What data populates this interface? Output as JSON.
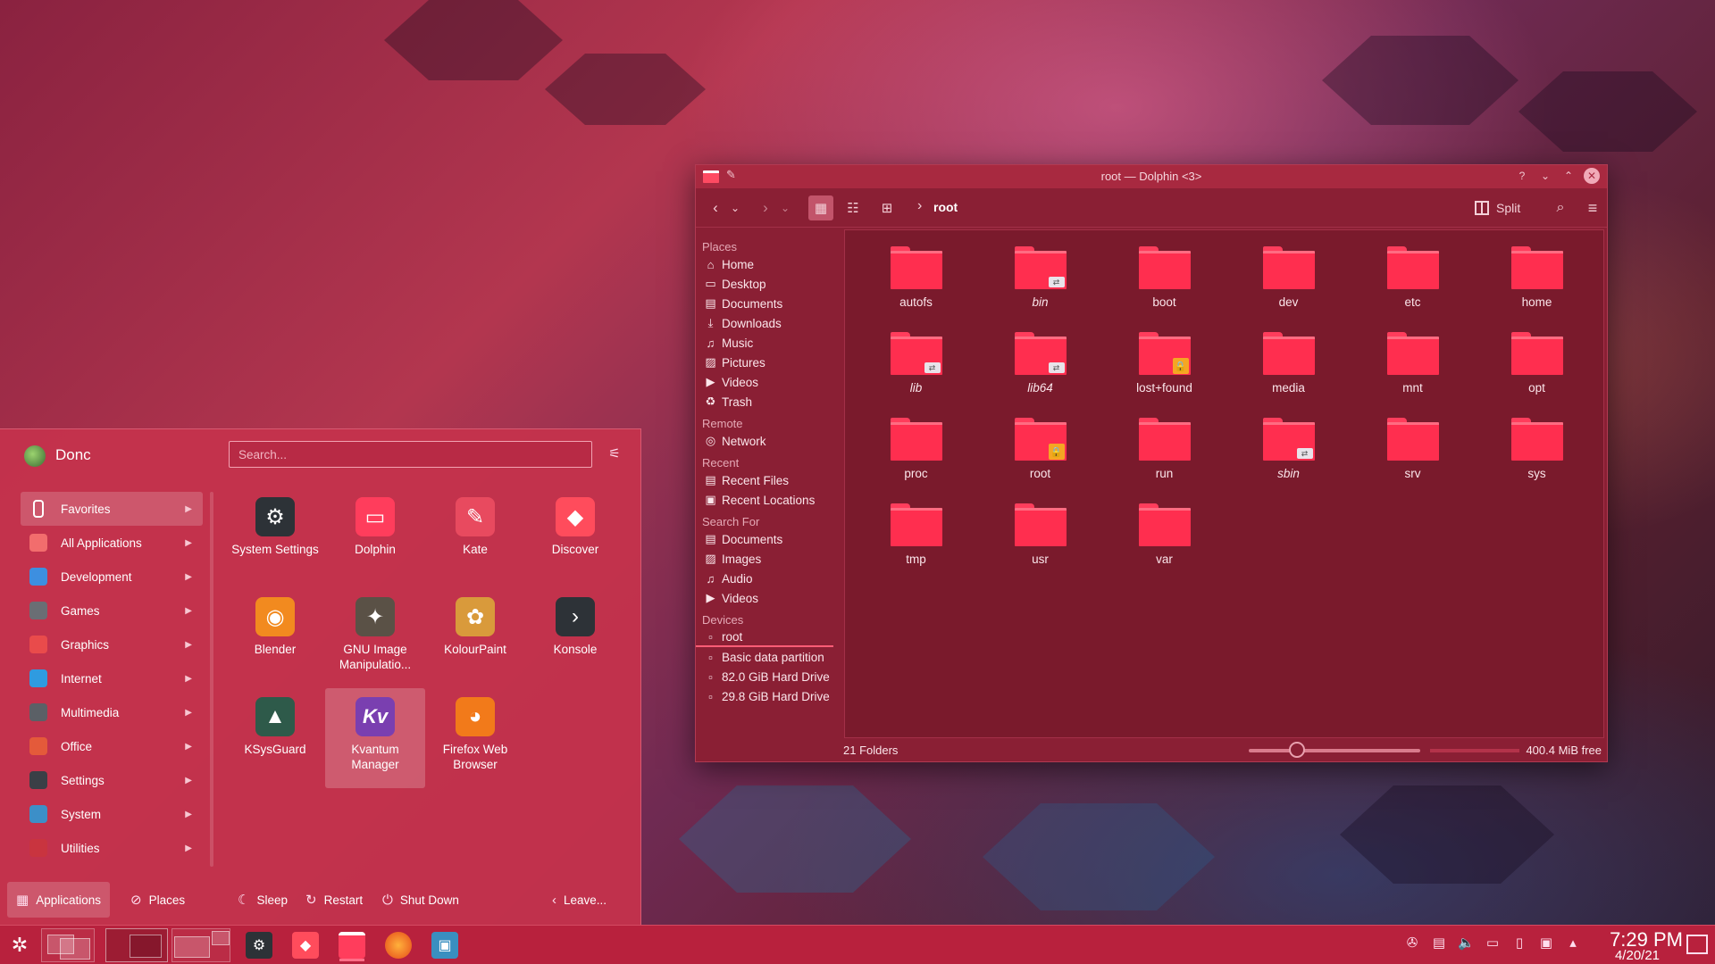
{
  "dolphin": {
    "title": "root — Dolphin <3>",
    "breadcrumb": "root",
    "split_label": "Split",
    "sections": [
      {
        "title": "Places",
        "items": [
          {
            "label": "Home",
            "icon": "home-icon"
          },
          {
            "label": "Desktop",
            "icon": "desktop-icon"
          },
          {
            "label": "Documents",
            "icon": "document-icon"
          },
          {
            "label": "Downloads",
            "icon": "download-icon"
          },
          {
            "label": "Music",
            "icon": "music-icon"
          },
          {
            "label": "Pictures",
            "icon": "picture-icon"
          },
          {
            "label": "Videos",
            "icon": "video-icon"
          },
          {
            "label": "Trash",
            "icon": "trash-icon"
          }
        ]
      },
      {
        "title": "Remote",
        "items": [
          {
            "label": "Network",
            "icon": "network-icon"
          }
        ]
      },
      {
        "title": "Recent",
        "items": [
          {
            "label": "Recent Files",
            "icon": "recent-files-icon"
          },
          {
            "label": "Recent Locations",
            "icon": "recent-locations-icon"
          }
        ]
      },
      {
        "title": "Search For",
        "items": [
          {
            "label": "Documents",
            "icon": "document-icon"
          },
          {
            "label": "Images",
            "icon": "picture-icon"
          },
          {
            "label": "Audio",
            "icon": "music-icon"
          },
          {
            "label": "Videos",
            "icon": "video-icon"
          }
        ]
      },
      {
        "title": "Devices",
        "items": [
          {
            "label": "root",
            "icon": "drive-icon"
          },
          {
            "label": "Basic data partition",
            "icon": "drive-icon"
          },
          {
            "label": "82.0 GiB Hard Drive",
            "icon": "drive-icon"
          },
          {
            "label": "29.8 GiB Hard Drive",
            "icon": "drive-icon"
          }
        ]
      }
    ],
    "folders": [
      {
        "name": "autofs",
        "badge": "",
        "italic": false
      },
      {
        "name": "bin",
        "badge": "link",
        "italic": true
      },
      {
        "name": "boot",
        "badge": "",
        "italic": false
      },
      {
        "name": "dev",
        "badge": "",
        "italic": false
      },
      {
        "name": "etc",
        "badge": "",
        "italic": false
      },
      {
        "name": "home",
        "badge": "",
        "italic": false
      },
      {
        "name": "lib",
        "badge": "link",
        "italic": true
      },
      {
        "name": "lib64",
        "badge": "link",
        "italic": true
      },
      {
        "name": "lost+found",
        "badge": "lock",
        "italic": false
      },
      {
        "name": "media",
        "badge": "",
        "italic": false
      },
      {
        "name": "mnt",
        "badge": "",
        "italic": false
      },
      {
        "name": "opt",
        "badge": "",
        "italic": false
      },
      {
        "name": "proc",
        "badge": "",
        "italic": false
      },
      {
        "name": "root",
        "badge": "lock",
        "italic": false
      },
      {
        "name": "run",
        "badge": "",
        "italic": false
      },
      {
        "name": "sbin",
        "badge": "link",
        "italic": true
      },
      {
        "name": "srv",
        "badge": "",
        "italic": false
      },
      {
        "name": "sys",
        "badge": "",
        "italic": false
      },
      {
        "name": "tmp",
        "badge": "",
        "italic": false
      },
      {
        "name": "usr",
        "badge": "",
        "italic": false
      },
      {
        "name": "var",
        "badge": "",
        "italic": false
      }
    ],
    "status": "21 Folders",
    "free_space": "400.4 MiB free"
  },
  "launcher": {
    "user": "Donc",
    "search_placeholder": "Search...",
    "categories": [
      {
        "label": "Favorites",
        "icon": "bookmark-icon",
        "color": "#ffffff"
      },
      {
        "label": "All Applications",
        "icon": "grid-icon",
        "color": "#f26d6d"
      },
      {
        "label": "Development",
        "icon": "development-icon",
        "color": "#3d8fe0"
      },
      {
        "label": "Games",
        "icon": "gamepad-icon",
        "color": "#6a6e74"
      },
      {
        "label": "Graphics",
        "icon": "graphics-icon",
        "color": "#e94b4b"
      },
      {
        "label": "Internet",
        "icon": "globe-icon",
        "color": "#2f9be0"
      },
      {
        "label": "Multimedia",
        "icon": "multimedia-icon",
        "color": "#5b6066"
      },
      {
        "label": "Office",
        "icon": "office-icon",
        "color": "#e45a3a"
      },
      {
        "label": "Settings",
        "icon": "settings-icon",
        "color": "#3a3f46"
      },
      {
        "label": "System",
        "icon": "system-icon",
        "color": "#3c8fc8"
      },
      {
        "label": "Utilities",
        "icon": "utilities-icon",
        "color": "#c9343f"
      }
    ],
    "apps": [
      {
        "label": "System Settings",
        "icon": "system-settings-icon",
        "color": "#2d3237",
        "glyph": "⚙"
      },
      {
        "label": "Dolphin",
        "icon": "dolphin-icon",
        "color": "#ff3d5c",
        "glyph": "▭"
      },
      {
        "label": "Kate",
        "icon": "kate-icon",
        "color": "#e84a5f",
        "glyph": "✎"
      },
      {
        "label": "Discover",
        "icon": "discover-icon",
        "color": "#ff4c5c",
        "glyph": "◆"
      },
      {
        "label": "Blender",
        "icon": "blender-icon",
        "color": "#f28a1f",
        "glyph": "◉"
      },
      {
        "label": "GNU Image Manipulatio...",
        "icon": "gimp-icon",
        "color": "#5a5146",
        "glyph": "✦"
      },
      {
        "label": "KolourPaint",
        "icon": "kolourpaint-icon",
        "color": "#d99a3b",
        "glyph": "✿"
      },
      {
        "label": "Konsole",
        "icon": "konsole-icon",
        "color": "#2d3237",
        "glyph": "›"
      },
      {
        "label": "KSysGuard",
        "icon": "ksysguard-icon",
        "color": "#2e5a4a",
        "glyph": "▲"
      },
      {
        "label": "Kvantum Manager",
        "icon": "kvantum-icon",
        "color": "#7a3fb0",
        "glyph": "Kv"
      },
      {
        "label": "Firefox Web Browser",
        "icon": "firefox-icon",
        "color": "#f27a1a",
        "glyph": "◕"
      }
    ],
    "footer": {
      "applications": "Applications",
      "places": "Places",
      "sleep": "Sleep",
      "restart": "Restart",
      "shutdown": "Shut Down",
      "leave": "Leave..."
    }
  },
  "taskbar": {
    "time": "7:29 PM",
    "date": "4/20/21"
  }
}
